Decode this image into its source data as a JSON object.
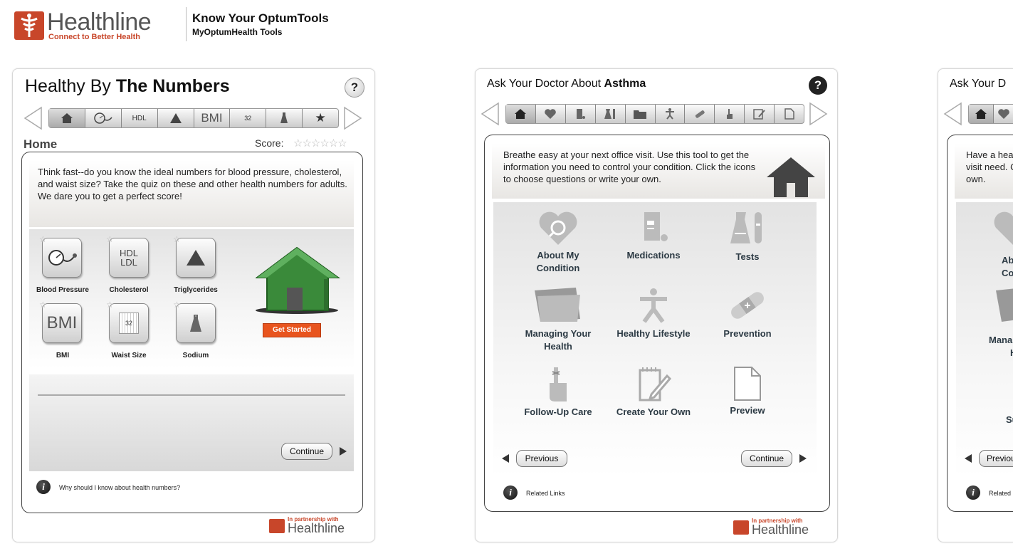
{
  "header": {
    "logo_text": "Healthline",
    "logo_tagline": "Connect to Better Health",
    "title": "Know Your OptumTools",
    "subtitle": "MyOptumHealth Tools"
  },
  "widget1": {
    "title_prefix": "Healthy By ",
    "title_bold": "The Numbers",
    "help": "?",
    "nav": [
      "home-icon",
      "blood-pressure-icon",
      "HDL",
      "triangle-icon",
      "BMI",
      "32",
      "sodium-icon",
      "star-icon"
    ],
    "section": "Home",
    "score_label": "Score:",
    "score_stars": "☆☆☆☆☆☆",
    "intro": "Think fast--do you know the ideal numbers for blood pressure, cholesterol, and waist size?  Take the quiz on these and other health numbers for adults. We dare you to get a perfect score!",
    "tiles": [
      {
        "label": "Blood Pressure",
        "icon": "blood-pressure-icon"
      },
      {
        "label": "Cholesterol",
        "icon": "HDL LDL"
      },
      {
        "label": "Triglycerides",
        "icon": "triangle-icon"
      },
      {
        "label": "BMI",
        "icon": "BMI"
      },
      {
        "label": "Waist Size",
        "icon": "32"
      },
      {
        "label": "Sodium",
        "icon": "sodium-icon"
      }
    ],
    "hdl": "HDL",
    "ldl": "LDL",
    "bmi": "BMI",
    "waist": "32",
    "get_started": "Get Started",
    "continue": "Continue",
    "info_text": "Why should I know about health numbers?",
    "partner_pre": "In partnership with",
    "partner_word": "Healthline",
    "colors": {
      "accent": "#e8541e",
      "house": "#3a8a3a",
      "brand": "#c8462a"
    }
  },
  "widget2": {
    "title_prefix": "Ask Your Doctor About ",
    "title_bold": "Asthma",
    "help": "?",
    "intro": "Breathe easy at your next office visit. Use this tool to get the information you need to control your condition. Click the icons to choose questions or write your own.",
    "items": [
      {
        "label": "About My Condition",
        "icon": "heart-magnifier-icon"
      },
      {
        "label": "Medications",
        "icon": "medication-icon"
      },
      {
        "label": "Tests",
        "icon": "test-tube-icon"
      },
      {
        "label": "Managing Your Health",
        "icon": "folder-icon"
      },
      {
        "label": "Healthy Lifestyle",
        "icon": "person-exercise-icon"
      },
      {
        "label": "Prevention",
        "icon": "bandage-icon"
      },
      {
        "label": "Follow-Up Care",
        "icon": "finger-string-icon"
      },
      {
        "label": "Create Your Own",
        "icon": "notepad-pencil-icon"
      },
      {
        "label": "Preview",
        "icon": "page-icon"
      }
    ],
    "previous": "Previous",
    "continue": "Continue",
    "info_text": "Related Links",
    "partner_pre": "In partnership with",
    "partner_word": "Healthline"
  },
  "widget3": {
    "title": "Ask Your D",
    "intro": "Have a hea doctor visit need. Click own.",
    "visible_labels": [
      "Ab",
      "Co",
      "Mana",
      "H",
      "Su"
    ],
    "previous": "Previou",
    "info_text": "Related"
  }
}
